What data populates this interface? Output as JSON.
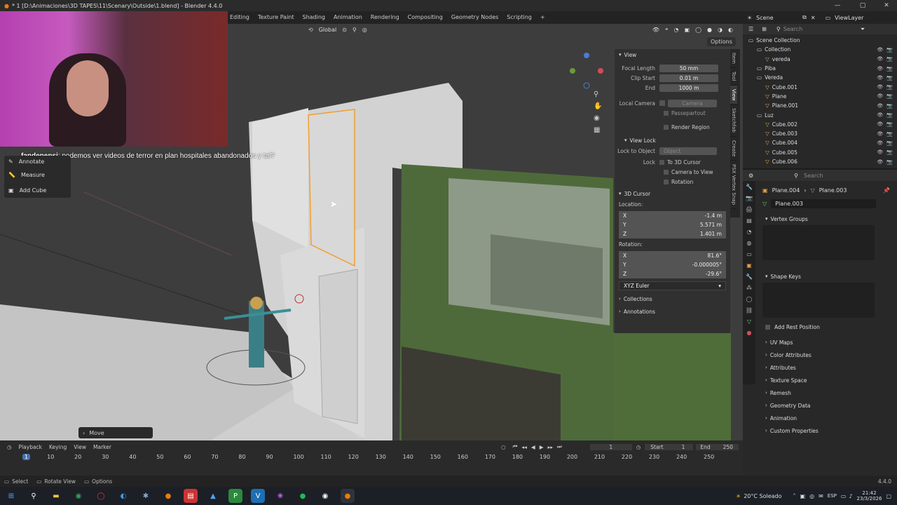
{
  "title_bar": {
    "title": "* 1 [D:\\Animaciones\\3D TAPES\\11\\Scenary\\Outside\\1.blend] - Blender 4.4.0"
  },
  "workspace_tabs": [
    "Editing",
    "Texture Paint",
    "Shading",
    "Animation",
    "Rendering",
    "Compositing",
    "Geometry Nodes",
    "Scripting"
  ],
  "viewport_header": {
    "orientation": "Global",
    "options_label": "Options"
  },
  "chat": {
    "user": "fandepepsi",
    "message": "podemos ver videos de terror en plan hospitales abandonados y tal?"
  },
  "tools": [
    "Annotate",
    "Measure",
    "Add Cube"
  ],
  "last_operator": "Move",
  "n_panel": {
    "view_header": "View",
    "focal_length_label": "Focal Length",
    "focal_length": "50 mm",
    "clip_start_label": "Clip Start",
    "clip_start": "0.01 m",
    "end_label": "End",
    "end": "1000 m",
    "local_camera_label": "Local Camera",
    "camera_placeholder": "Camera",
    "passepartout": "Passepartout",
    "render_region": "Render Region",
    "view_lock_header": "View Lock",
    "lock_to_object_label": "Lock to Object",
    "object_placeholder": "Object",
    "lock_label": "Lock",
    "to_3d_cursor": "To 3D Cursor",
    "camera_to_view": "Camera to View",
    "rotation_lock": "Rotation",
    "cursor_header": "3D Cursor",
    "location_label": "Location:",
    "loc": [
      {
        "axis": "X",
        "value": "-1.4 m"
      },
      {
        "axis": "Y",
        "value": "5.571 m"
      },
      {
        "axis": "Z",
        "value": "1.401 m"
      }
    ],
    "rotation_label": "Rotation:",
    "rot": [
      {
        "axis": "X",
        "value": "81.6°"
      },
      {
        "axis": "Y",
        "value": "-0.000005°"
      },
      {
        "axis": "Z",
        "value": "-29.6°"
      }
    ],
    "rotation_mode": "XYZ Euler",
    "collections": "Collections",
    "annotations": "Annotations"
  },
  "side_tabs": [
    "Item",
    "Tool",
    "View",
    "Sketchfab",
    "Create",
    "PSX Vertex Snap"
  ],
  "outliner": {
    "scene": "Scene",
    "view_layer": "ViewLayer",
    "search_placeholder": "Search",
    "rows": [
      {
        "name": "Scene Collection",
        "indent": 0
      },
      {
        "name": "Collection",
        "indent": 1
      },
      {
        "name": "vereda",
        "indent": 2
      },
      {
        "name": "Piba",
        "indent": 1
      },
      {
        "name": "Vereda",
        "indent": 1
      },
      {
        "name": "Cube.001",
        "indent": 2
      },
      {
        "name": "Plane",
        "indent": 2
      },
      {
        "name": "Plane.001",
        "indent": 2
      },
      {
        "name": "Luz",
        "indent": 1
      },
      {
        "name": "Cube.002",
        "indent": 2
      },
      {
        "name": "Cube.003",
        "indent": 2
      },
      {
        "name": "Cube.004",
        "indent": 2
      },
      {
        "name": "Cube.005",
        "indent": 2
      },
      {
        "name": "Cube.006",
        "indent": 2
      }
    ]
  },
  "properties": {
    "search_placeholder": "Search",
    "object": "Plane.004",
    "mesh": "Plane.003",
    "data_name": "Plane.003",
    "vertex_groups": "Vertex Groups",
    "shape_keys": "Shape Keys",
    "add_rest_position": "Add Rest Position",
    "sections": [
      "UV Maps",
      "Color Attributes",
      "Attributes",
      "Texture Space",
      "Remesh",
      "Geometry Data",
      "Animation",
      "Custom Properties"
    ]
  },
  "timeline": {
    "menus": [
      "Playback",
      "Keying",
      "View",
      "Marker"
    ],
    "current_frame": "1",
    "start_label": "Start",
    "start": "1",
    "end_label": "End",
    "end": "250",
    "ruler": [
      "1",
      "10",
      "20",
      "30",
      "40",
      "50",
      "60",
      "70",
      "80",
      "90",
      "100",
      "110",
      "120",
      "130",
      "140",
      "150",
      "160",
      "170",
      "180",
      "190",
      "200",
      "210",
      "220",
      "230",
      "240",
      "250"
    ]
  },
  "status_bar": {
    "select": "Select",
    "rotate_view": "Rotate View",
    "options": "Options",
    "version": "4.4.0"
  },
  "taskbar": {
    "weather": "20°C Soleado",
    "lang": "ESP",
    "time": "21:42",
    "date": "23/3/2026"
  }
}
